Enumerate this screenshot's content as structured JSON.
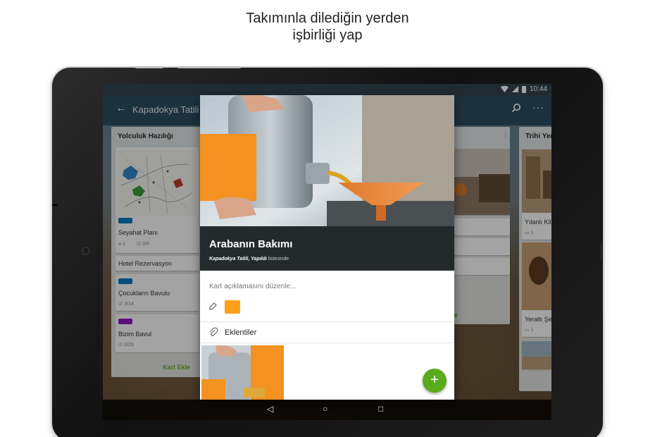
{
  "headline": {
    "line1": "Takımınla dilediğin yerden",
    "line2": "işbirliği yap"
  },
  "status_bar": {
    "time": "10:44"
  },
  "app_bar": {
    "back_icon": "←",
    "board_title": "Kapadokya Tatili",
    "more_icon": "⋮"
  },
  "lists": [
    {
      "title": "Yolculuk Hazılığı",
      "cards": [
        {
          "title": "Seyahat Planı",
          "label_color": "#0079bf",
          "badges": [
            "1",
            "0/6"
          ]
        },
        {
          "title": "Hotel Rezervasyon"
        },
        {
          "title": "Çocukların Bavulu",
          "label_color": "#0079bf",
          "badges": [
            "3/14"
          ]
        },
        {
          "title": "Bizim Bavul",
          "label_color": "#8a18c4",
          "badges": [
            "0/29"
          ]
        }
      ],
      "add_card": "Kart Ekle"
    },
    {
      "title": "Trihi Yer",
      "cards": [
        {
          "title": "Yılanlı Kil",
          "badges": [
            "1"
          ]
        },
        {
          "title": "Yeraltı Şe",
          "badges": [
            "1"
          ]
        }
      ]
    }
  ],
  "middle_list": {
    "partial_add": "le"
  },
  "card_detail": {
    "name": "Arabanın Bakımı",
    "board": "Kapadokya Tatili",
    "list": "Yapıldı",
    "list_suffix": "listesinde",
    "description_placeholder": "Kart açıklamasını düzenle...",
    "label_color": "#ff9f1a",
    "attachments_label": "Eklentiler",
    "fab_icon": "+"
  },
  "nav": {
    "back": "◁",
    "home": "○",
    "recents": "□"
  },
  "colors": {
    "app_bar": "#28485c",
    "accent_green": "#5aaa1c",
    "card_header": "#242a2b"
  }
}
